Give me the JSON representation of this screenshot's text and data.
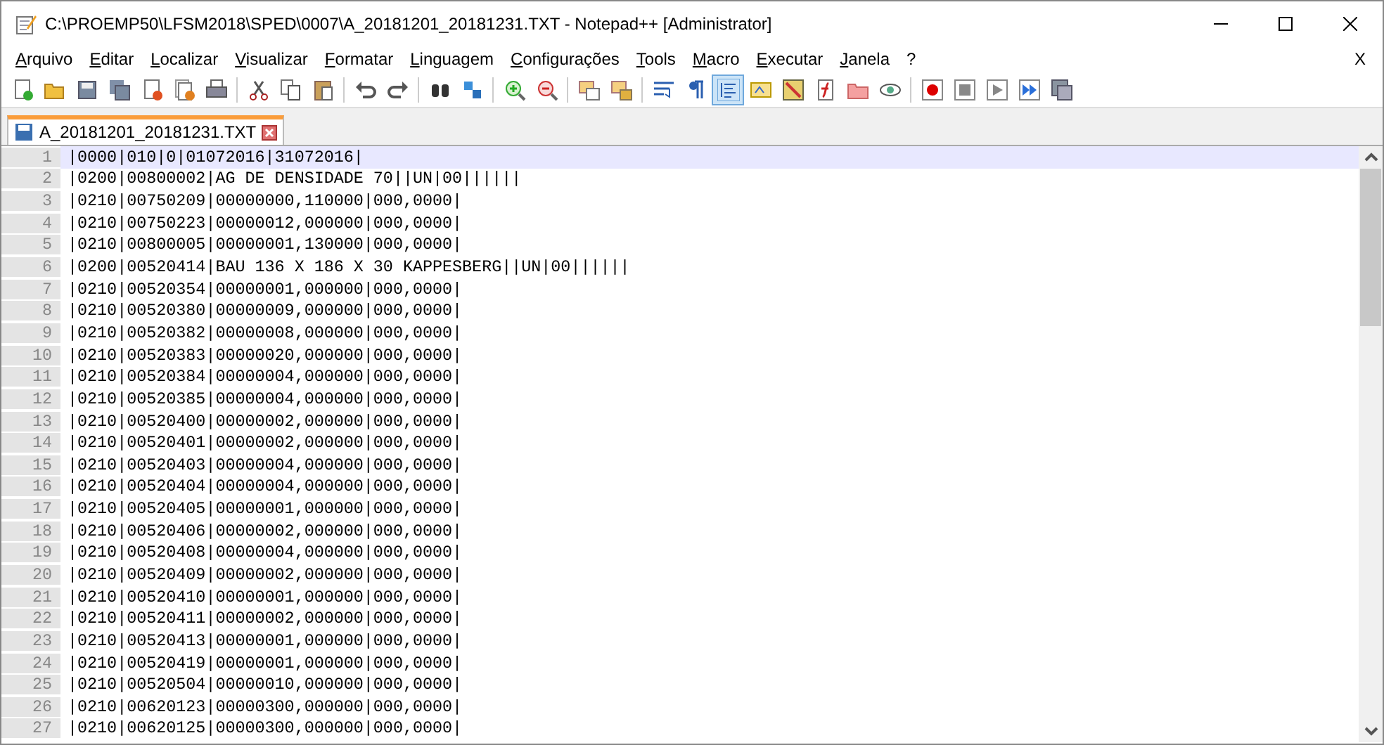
{
  "window": {
    "title": "C:\\PROEMP50\\LFSM2018\\SPED\\0007\\A_20181201_20181231.TXT - Notepad++ [Administrator]"
  },
  "menu": [
    "Arquivo",
    "Editar",
    "Localizar",
    "Visualizar",
    "Formatar",
    "Linguagem",
    "Configurações",
    "Tools",
    "Macro",
    "Executar",
    "Janela",
    "?"
  ],
  "menu_close": "X",
  "tabs": [
    {
      "label": "A_20181201_20181231.TXT",
      "selected": true
    }
  ],
  "lines": [
    {
      "number": "1",
      "text": "|0000|010|0|01072016|31072016|",
      "selected": true
    },
    {
      "number": "2",
      "text": "|0200|00800002|AG DE DENSIDADE 70||UN|00||||||",
      "selected": false
    },
    {
      "number": "3",
      "text": "|0210|00750209|00000000,110000|000,0000|",
      "selected": false
    },
    {
      "number": "4",
      "text": "|0210|00750223|00000012,000000|000,0000|",
      "selected": false
    },
    {
      "number": "5",
      "text": "|0210|00800005|00000001,130000|000,0000|",
      "selected": false
    },
    {
      "number": "6",
      "text": "|0200|00520414|BAU 136 X 186 X 30 KAPPESBERG||UN|00||||||",
      "selected": false
    },
    {
      "number": "7",
      "text": "|0210|00520354|00000001,000000|000,0000|",
      "selected": false
    },
    {
      "number": "8",
      "text": "|0210|00520380|00000009,000000|000,0000|",
      "selected": false
    },
    {
      "number": "9",
      "text": "|0210|00520382|00000008,000000|000,0000|",
      "selected": false
    },
    {
      "number": "10",
      "text": "|0210|00520383|00000020,000000|000,0000|",
      "selected": false
    },
    {
      "number": "11",
      "text": "|0210|00520384|00000004,000000|000,0000|",
      "selected": false
    },
    {
      "number": "12",
      "text": "|0210|00520385|00000004,000000|000,0000|",
      "selected": false
    },
    {
      "number": "13",
      "text": "|0210|00520400|00000002,000000|000,0000|",
      "selected": false
    },
    {
      "number": "14",
      "text": "|0210|00520401|00000002,000000|000,0000|",
      "selected": false
    },
    {
      "number": "15",
      "text": "|0210|00520403|00000004,000000|000,0000|",
      "selected": false
    },
    {
      "number": "16",
      "text": "|0210|00520404|00000004,000000|000,0000|",
      "selected": false
    },
    {
      "number": "17",
      "text": "|0210|00520405|00000001,000000|000,0000|",
      "selected": false
    },
    {
      "number": "18",
      "text": "|0210|00520406|00000002,000000|000,0000|",
      "selected": false
    },
    {
      "number": "19",
      "text": "|0210|00520408|00000004,000000|000,0000|",
      "selected": false
    },
    {
      "number": "20",
      "text": "|0210|00520409|00000002,000000|000,0000|",
      "selected": false
    },
    {
      "number": "21",
      "text": "|0210|00520410|00000001,000000|000,0000|",
      "selected": false
    },
    {
      "number": "22",
      "text": "|0210|00520411|00000002,000000|000,0000|",
      "selected": false
    },
    {
      "number": "23",
      "text": "|0210|00520413|00000001,000000|000,0000|",
      "selected": false
    },
    {
      "number": "24",
      "text": "|0210|00520419|00000001,000000|000,0000|",
      "selected": false
    },
    {
      "number": "25",
      "text": "|0210|00520504|00000010,000000|000,0000|",
      "selected": false
    },
    {
      "number": "26",
      "text": "|0210|00620123|00000300,000000|000,0000|",
      "selected": false
    },
    {
      "number": "27",
      "text": "|0210|00620125|00000300,000000|000,0000|",
      "selected": false
    }
  ]
}
